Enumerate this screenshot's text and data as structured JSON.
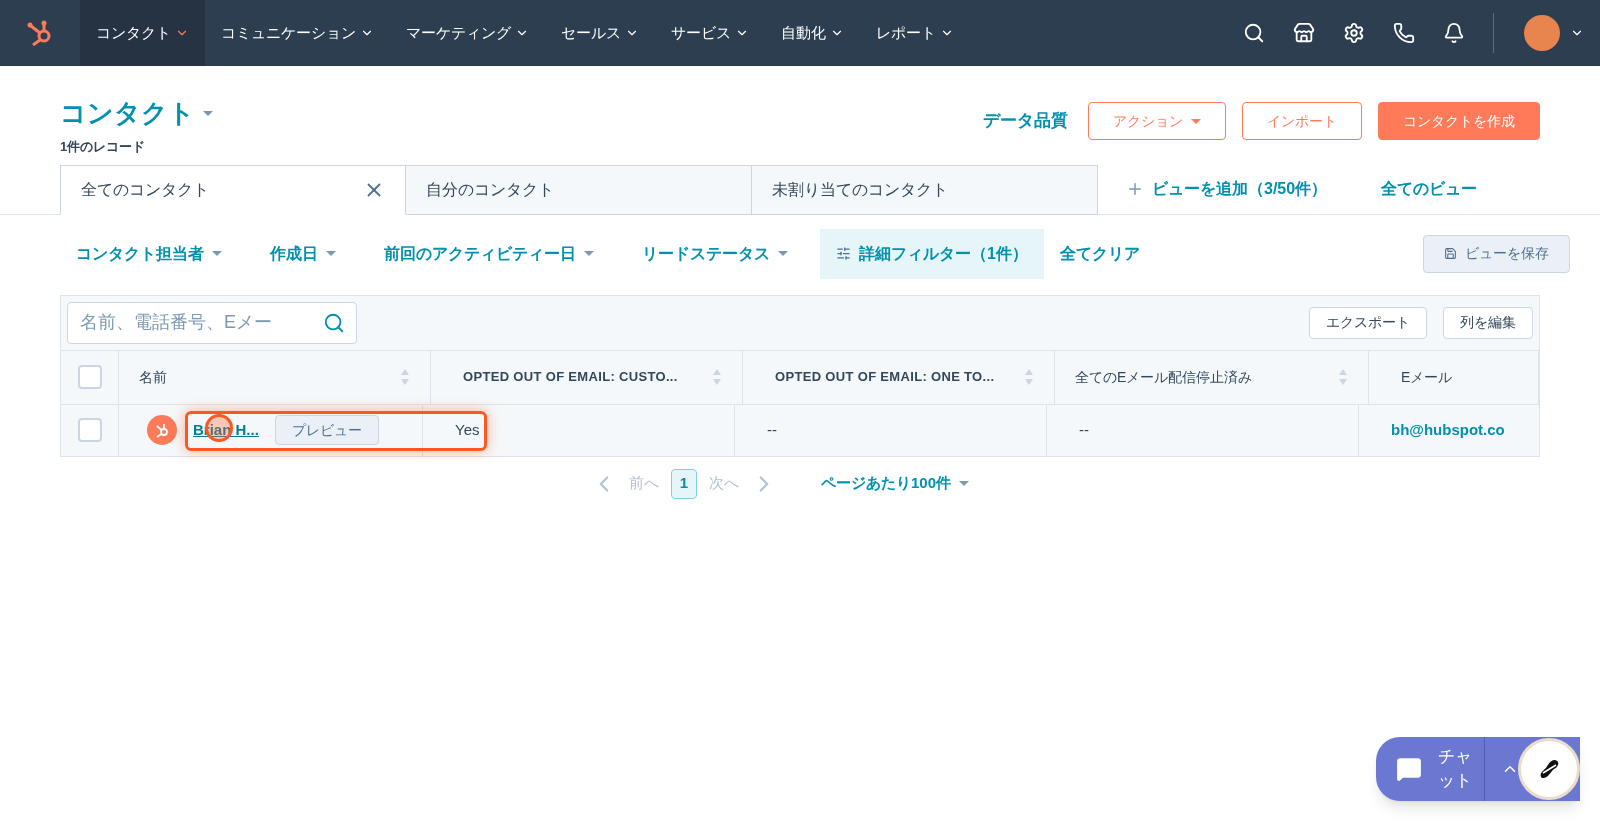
{
  "nav": {
    "items": [
      {
        "label": "コンタクト",
        "selected": true
      },
      {
        "label": "コミュニケーション",
        "selected": false
      },
      {
        "label": "マーケティング",
        "selected": false
      },
      {
        "label": "セールス",
        "selected": false
      },
      {
        "label": "サービス",
        "selected": false
      },
      {
        "label": "自動化",
        "selected": false
      },
      {
        "label": "レポート",
        "selected": false
      }
    ]
  },
  "header": {
    "title": "コンタクト",
    "record_count": "1件のレコード",
    "links": [
      "データ品質"
    ],
    "buttons": [
      {
        "label": "アクション",
        "kind": "dropdown"
      },
      {
        "label": "インポート",
        "kind": "outline"
      },
      {
        "label": "コンタクトを作成",
        "kind": "primary"
      }
    ]
  },
  "view_tabs": [
    {
      "label": "全てのコンタクト",
      "selected": true
    },
    {
      "label": "自分のコンタクト",
      "selected": false
    },
    {
      "label": "未割り当てのコンタクト",
      "selected": false
    }
  ],
  "view_links": {
    "add": "ビューを追加（3/50件）",
    "all": "全てのビュー"
  },
  "filters": [
    {
      "label": "コンタクト担当者",
      "kind": "dropdown"
    },
    {
      "label": "作成日",
      "kind": "dropdown"
    },
    {
      "label": "前回のアクティビティー日",
      "kind": "dropdown"
    },
    {
      "label": "リードステータス",
      "kind": "dropdown"
    },
    {
      "label": "詳細フィルター（1件）",
      "kind": "advanced"
    },
    {
      "label": "全てクリア",
      "kind": "link"
    }
  ],
  "save_view": "ビューを保存",
  "table": {
    "search": {
      "placeholder": "名前、電話番号、Eメー"
    },
    "actions": [
      "エクスポート",
      "列を編集"
    ],
    "select_all_checked": false,
    "columns": [
      {
        "label": "名前",
        "sortable": true,
        "bold": false,
        "kind": "name"
      },
      {
        "label": "OPTED OUT OF EMAIL: CUSTO...",
        "sortable": true,
        "bold": true,
        "kind": "text"
      },
      {
        "label": "OPTED OUT OF EMAIL: ONE TO...",
        "sortable": true,
        "bold": true,
        "kind": "text"
      },
      {
        "label": "全てのEメール配信停止済み",
        "sortable": true,
        "bold": false,
        "kind": "text"
      },
      {
        "label": "Eメール",
        "sortable": false,
        "bold": false,
        "kind": "email"
      }
    ],
    "rows": [
      {
        "checked": false,
        "preview": "プレビュー",
        "cells": [
          "Brian H...",
          "Yes",
          "--",
          "--",
          "bh@hubspot.co"
        ]
      }
    ]
  },
  "pagination": {
    "prev": "前へ",
    "page": "1",
    "next": "次へ",
    "per_page": "ページあたり100件"
  },
  "chat": {
    "label": "チャット"
  }
}
